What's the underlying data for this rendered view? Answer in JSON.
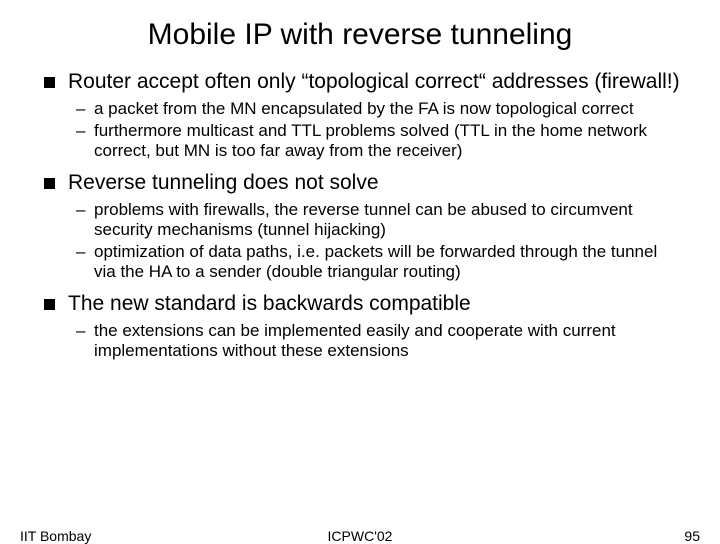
{
  "title": "Mobile IP with reverse tunneling",
  "bullets": [
    {
      "text": "Router accept often only “topological correct“ addresses (firewall!)",
      "subs": [
        "a packet from the MN encapsulated by the FA is now topological correct",
        "furthermore multicast and TTL problems solved (TTL in the home network correct, but MN is too far away from the receiver)"
      ]
    },
    {
      "text": "Reverse tunneling does not solve",
      "subs": [
        "problems with firewalls, the reverse tunnel can be abused to circumvent security mechanisms (tunnel hijacking)",
        "optimization of data paths, i.e. packets will be forwarded through the tunnel via the HA to a sender (double triangular routing)"
      ]
    },
    {
      "text": "The new standard is backwards compatible",
      "subs": [
        "the extensions can be implemented easily and cooperate with current implementations without these extensions"
      ]
    }
  ],
  "footer": {
    "left": "IIT Bombay",
    "center": "ICPWC'02",
    "right": "95"
  }
}
